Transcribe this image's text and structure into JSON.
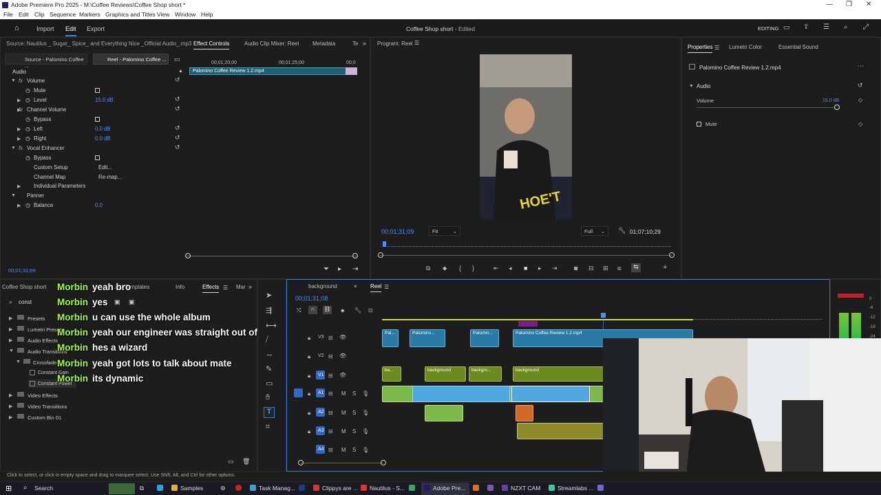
{
  "window": {
    "title": "Adobe Premiere Pro 2025 - M:\\Coffee Reviews\\Coffee Shop short *"
  },
  "menu": [
    "File",
    "Edit",
    "Clip",
    "Sequence",
    "Markers",
    "Graphics and Titles",
    "View",
    "Window",
    "Help"
  ],
  "header": {
    "nav": [
      "Import",
      "Edit",
      "Export"
    ],
    "active": "Edit",
    "program_title": "Coffee Shop short",
    "program_status": "- Edited",
    "workspace": "EDITING"
  },
  "source_panel": {
    "source_tab": "Source: Nautilus _ Sugar_ Spice_ and Everything Nice _Official Audio_.mp3",
    "tabs": [
      "Effect Controls",
      "Audio Clip Mixer: Reel",
      "Metadata",
      "Te"
    ],
    "sub_tabs": [
      "Source - Palomino Coffee ...",
      "Reel - Palomino Coffee ..."
    ],
    "ruler": [
      "00;01;20;00",
      "00;01;25;00",
      "00;0"
    ],
    "clip_name": "Palomino Coffee Review 1.2.mp4",
    "section": "Audio",
    "rows": [
      {
        "label": "Volume",
        "value": ""
      },
      {
        "label": "Mute",
        "value": ""
      },
      {
        "label": "Level",
        "value": "15.0 dB"
      },
      {
        "label": "Channel Volume",
        "value": ""
      },
      {
        "label": "Bypass",
        "value": ""
      },
      {
        "label": "Left",
        "value": "0.0 dB"
      },
      {
        "label": "Right",
        "value": "0.0 dB"
      },
      {
        "label": "Vocal Enhancer",
        "value": ""
      },
      {
        "label": "Bypass",
        "value": ""
      },
      {
        "label": "Custom Setup",
        "value": "Edit..."
      },
      {
        "label": "Channel Map",
        "value": "Re-map..."
      },
      {
        "label": "Individual Parameters",
        "value": ""
      },
      {
        "label": "Panner",
        "value": ""
      },
      {
        "label": "Balance",
        "value": "0.0"
      }
    ],
    "timecode": "00;01;31;09"
  },
  "program_monitor": {
    "tab": "Program: Reel",
    "timecode": "00;01;31;09",
    "fit": "Fit",
    "quality": "Full",
    "duration": "01;07;10;29"
  },
  "properties": {
    "tabs": [
      "Properties",
      "Lumetri Color",
      "Essential Sound"
    ],
    "clip": "Palomino Coffee Review 1.2.mp4",
    "section": "Audio",
    "volume_label": "Volume",
    "volume_value": "15.0 dB",
    "mute_label": "Mute"
  },
  "project_panel": {
    "tabs": [
      "Coffee Shop short",
      "...ary Templates",
      "Info",
      "Effects",
      "Mar"
    ],
    "search": "const",
    "tree": [
      {
        "label": "Presets",
        "level": 0
      },
      {
        "label": "Lumetri Presets",
        "level": 0
      },
      {
        "label": "Audio Effects",
        "level": 0
      },
      {
        "label": "Audio Transitions",
        "level": 0
      },
      {
        "label": "Crossfade",
        "level": 1
      },
      {
        "label": "Constant Gain",
        "level": 2
      },
      {
        "label": "Constant Power",
        "level": 2
      },
      {
        "label": "Video Effects",
        "level": 0
      },
      {
        "label": "Video Transitions",
        "level": 0
      },
      {
        "label": "Custom Bin 01",
        "level": 0
      }
    ]
  },
  "chat": [
    {
      "name": "Morbin",
      "text": "yeah bro"
    },
    {
      "name": "Morbin",
      "text": "yes"
    },
    {
      "name": "Morbin",
      "text": "u can use the whole album"
    },
    {
      "name": "Morbin",
      "text": "yeah our engineer was straight out of berkley"
    },
    {
      "name": "Morbin",
      "text": "hes a wizard"
    },
    {
      "name": "Morbin",
      "text": "yeah got lots to talk about mate"
    },
    {
      "name": "Morbin",
      "text": "its dynamic"
    }
  ],
  "timeline": {
    "tabs": [
      "background",
      "Reel"
    ],
    "timecode": "00;01;31;08",
    "tracks": [
      "V3",
      "V2",
      "V1",
      "A1",
      "A2",
      "A3",
      "A4"
    ],
    "clips_v": [
      "Pal...",
      "Palomino...",
      "Palomin...",
      "Palomino Coffee Review 1.2.mp4"
    ],
    "clips_bg": [
      "ba...",
      "background",
      "backgro...",
      "background"
    ]
  },
  "meter": {
    "labels": [
      "0",
      "-6",
      "-12",
      "-18",
      "-24"
    ]
  },
  "status_bar": "Click to select, or click in empty space and drag to marquee select. Use Shift, Alt, and Ctrl for other options.",
  "taskbar": {
    "search": "Search",
    "items": [
      "Samples",
      "Task Manag...",
      "Clippys are ...",
      "Nautilus - S...",
      "Adobe Pre...",
      "NZXT CAM",
      "Streamlabs ..."
    ]
  }
}
